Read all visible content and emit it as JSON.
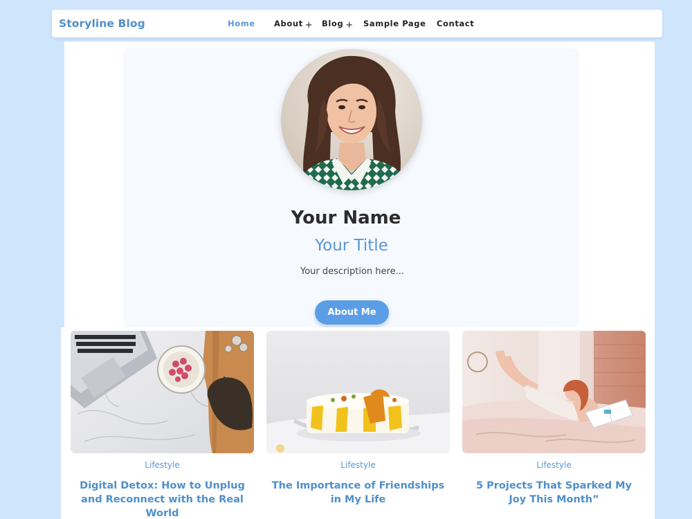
{
  "header": {
    "logo": "Storyline Blog",
    "nav": [
      {
        "label": "Home",
        "has_submenu": false,
        "active": true
      },
      {
        "label": "About",
        "has_submenu": true,
        "active": false
      },
      {
        "label": "Blog",
        "has_submenu": true,
        "active": false
      },
      {
        "label": "Sample Page",
        "has_submenu": false,
        "active": false
      },
      {
        "label": "Contact",
        "has_submenu": false,
        "active": false
      }
    ],
    "submenu_icon": "+"
  },
  "profile": {
    "avatar_icon": "profile-photo",
    "name": "Your Name",
    "title": "Your Title",
    "description": "Your description here...",
    "button_label": "About Me"
  },
  "posts": [
    {
      "category": "Lifestyle",
      "title": "Digital Detox: How to Unplug and Reconnect with the Real World",
      "image": "laptop-desk-photo"
    },
    {
      "category": "Lifestyle",
      "title": "The Importance of Friendships in My Life",
      "image": "cake-photo"
    },
    {
      "category": "Lifestyle",
      "title": "5 Projects That Sparked My Joy This Month”",
      "image": "woman-reading-bed-photo"
    }
  ],
  "colors": {
    "background": "#cfe5fb",
    "accent": "#5b96d6",
    "button": "#5b9ee6",
    "text_dark": "#2c2c2c"
  }
}
